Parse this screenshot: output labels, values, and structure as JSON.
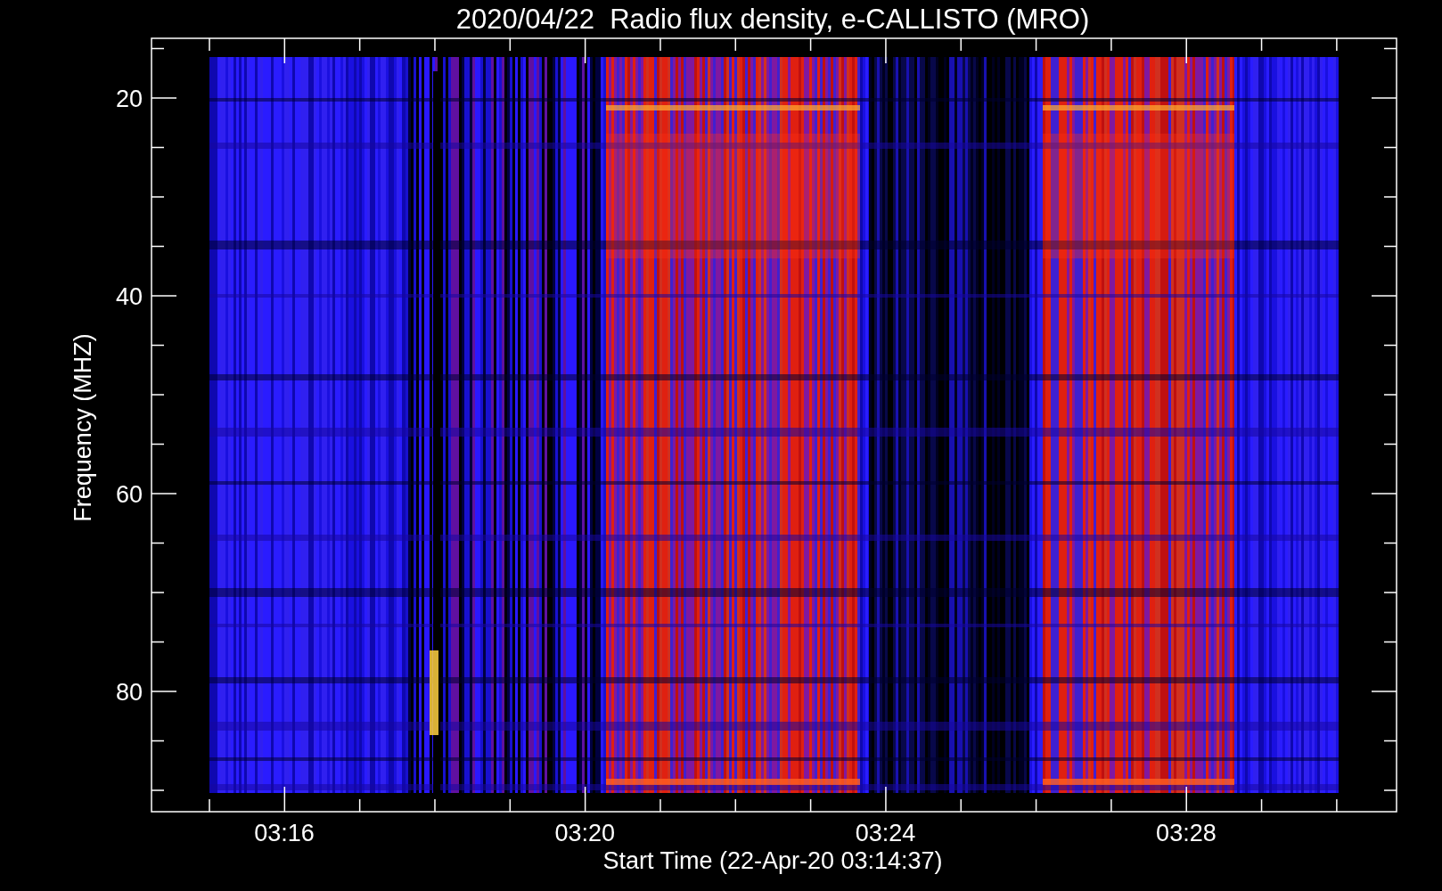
{
  "title": "2020/04/22  Radio flux density, e-CALLISTO (MRO)",
  "plot": {
    "xlabel": "Start Time (22-Apr-20 03:14:37)",
    "ylabel": "Frequency (MHZ)",
    "xticks": [
      "03:16",
      "03:20",
      "03:24",
      "03:28"
    ],
    "yticks": [
      "20",
      "40",
      "60",
      "80"
    ]
  }
}
